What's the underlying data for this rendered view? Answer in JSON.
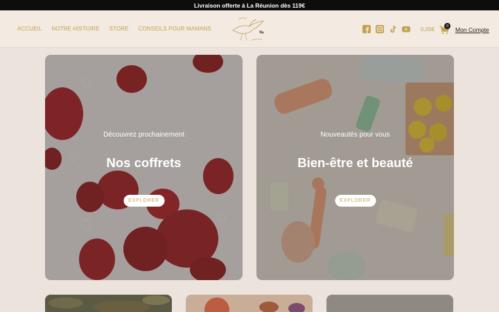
{
  "topbar": {
    "text": "Livraison offerte à La Réunion dès 119€"
  },
  "nav": {
    "items": [
      {
        "label": "ACCUEIL"
      },
      {
        "label": "NOTRE HISTOIRE"
      },
      {
        "label": "STORE"
      },
      {
        "label": "CONSEILS POUR MAMANS"
      }
    ]
  },
  "logo": {
    "text": "Cigogne Australe"
  },
  "social": {
    "icons": [
      "facebook-icon",
      "instagram-icon",
      "tiktok-icon",
      "youtube-icon"
    ]
  },
  "cart": {
    "amount": "0,00€",
    "count": "0"
  },
  "account": {
    "label": "Mon Compte"
  },
  "cards": [
    {
      "subtitle": "Découvrez prochainement",
      "title": "Nos coffrets",
      "button": "EXPLORER"
    },
    {
      "subtitle": "Nouveautés pour vous",
      "title": "Bien-être et beauté",
      "button": "EXPLORER"
    }
  ],
  "colors": {
    "accent": "#c4a052",
    "topbar": "#0d0d0d",
    "header": "#f3ebe1",
    "page": "#ece4dc"
  }
}
